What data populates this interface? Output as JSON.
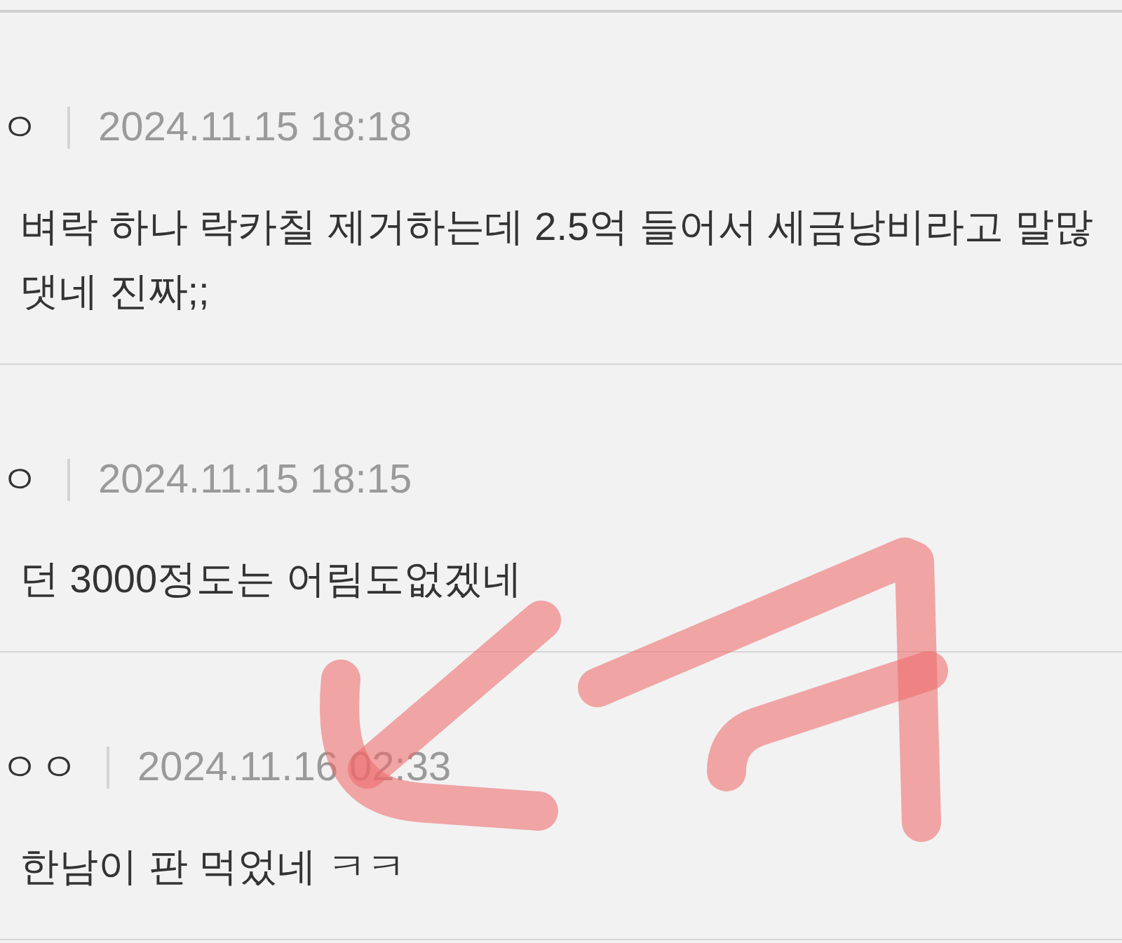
{
  "comments": [
    {
      "author": "ㅇ",
      "date": "2024.11.15 18:18",
      "lines": [
        "벼락 하나 락카칠 제거하는데 2.5억 들어서 세금낭비라고 말많",
        "댓네 진짜;;"
      ]
    },
    {
      "author": "ㅇ",
      "date": "2024.11.15 18:15",
      "lines": [
        "던 3000정도는 어림도없겠네"
      ]
    },
    {
      "author": "ㅇㅇ",
      "date": "2024.11.16 02:33",
      "lines": [
        "한남이 판 먹었네 ㅋㅋ"
      ]
    }
  ]
}
